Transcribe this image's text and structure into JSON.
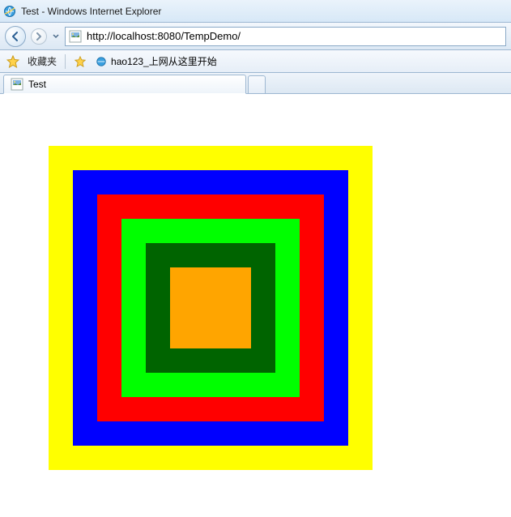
{
  "window": {
    "title": "Test - Windows Internet Explorer"
  },
  "address": {
    "url": "http://localhost:8080/TempDemo/"
  },
  "favorites": {
    "label": "收藏夹",
    "link1_label": "hao123_上网从这里开始"
  },
  "tab": {
    "title": "Test"
  },
  "squares": {
    "outer_size": 400,
    "inset": 30,
    "colors": [
      "#ffff00",
      "#0000ff",
      "#ff0000",
      "#00ff00",
      "#006400",
      "#ffa500"
    ]
  }
}
